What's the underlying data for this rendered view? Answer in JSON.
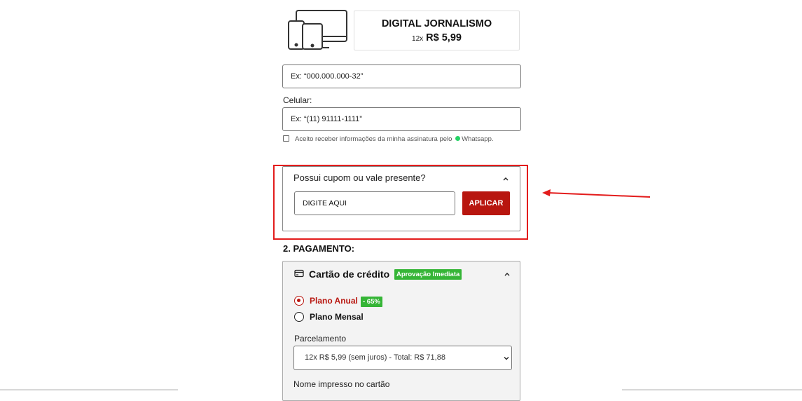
{
  "product": {
    "name": "DIGITAL JORNALISMO",
    "installments": "12x",
    "price": "R$ 5,99",
    "icon": "devices-icon"
  },
  "form": {
    "cpf_placeholder": "Ex: “000.000.000-32”",
    "phone_label": "Celular:",
    "phone_placeholder": "Ex: “(11) 91111-1111”",
    "consent_text": "Aceito receber informações da minha assinatura pelo",
    "consent_channel": "Whatsapp."
  },
  "coupon": {
    "title": "Possui cupom ou vale presente?",
    "input_value": "DIGITE AQUI",
    "apply_label": "APLICAR"
  },
  "payment": {
    "section_title": "2. PAGAMENTO:",
    "method_title": "Cartão de crédito",
    "approval_badge": "Aprovação Imediata",
    "plans": [
      {
        "label": "Plano Anual",
        "badge": "- 65%",
        "selected": true
      },
      {
        "label": "Plano Mensal",
        "selected": false
      }
    ],
    "installments_label": "Parcelamento",
    "installments_value": "12x R$ 5,99 (sem juros) - Total: R$ 71,88",
    "card_name_label": "Nome impresso no cartão"
  },
  "colors": {
    "brand_red": "#b8160f",
    "badge_green": "#35b536",
    "annotation_red": "#e31c1c"
  }
}
